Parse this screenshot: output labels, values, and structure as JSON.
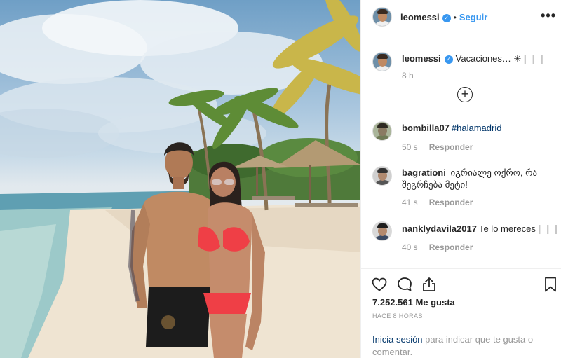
{
  "post": {
    "photo_alt": "Beach photo",
    "author": "leomessi",
    "follow_label": "Seguir",
    "separator": "•",
    "more_label": "•••"
  },
  "caption": {
    "username": "leomessi",
    "text": "Vacaciones… ✳",
    "extra": "❙❙❙",
    "time": "8 h"
  },
  "comments": [
    {
      "username": "bombilla07",
      "text": "",
      "hashtag": "#halamadrid",
      "time": "50 s",
      "reply": "Responder"
    },
    {
      "username": "bagrationi",
      "text": "იგრიალე ოქრო, რა შეგრჩება მეტი!",
      "hashtag": "",
      "time": "41 s",
      "reply": "Responder"
    },
    {
      "username": "nanklydavila2017",
      "text": "Te lo mereces",
      "extra": "❙❙❙❙❙",
      "time": "40 s",
      "reply": "Responder"
    }
  ],
  "actions": {
    "likes": "7.252.561 Me gusta",
    "timestamp": "HACE 8 HORAS",
    "login_link": "Inicia sesión",
    "login_text": " para indicar que te gusta o comentar."
  },
  "icons": {
    "load_more": "add-circle-icon",
    "like": "heart-icon",
    "comment": "comment-icon",
    "share": "share-icon",
    "save": "bookmark-icon"
  },
  "colors": {
    "accent": "#3897f0",
    "link": "#003569",
    "muted": "#999999",
    "border": "#efefef"
  }
}
